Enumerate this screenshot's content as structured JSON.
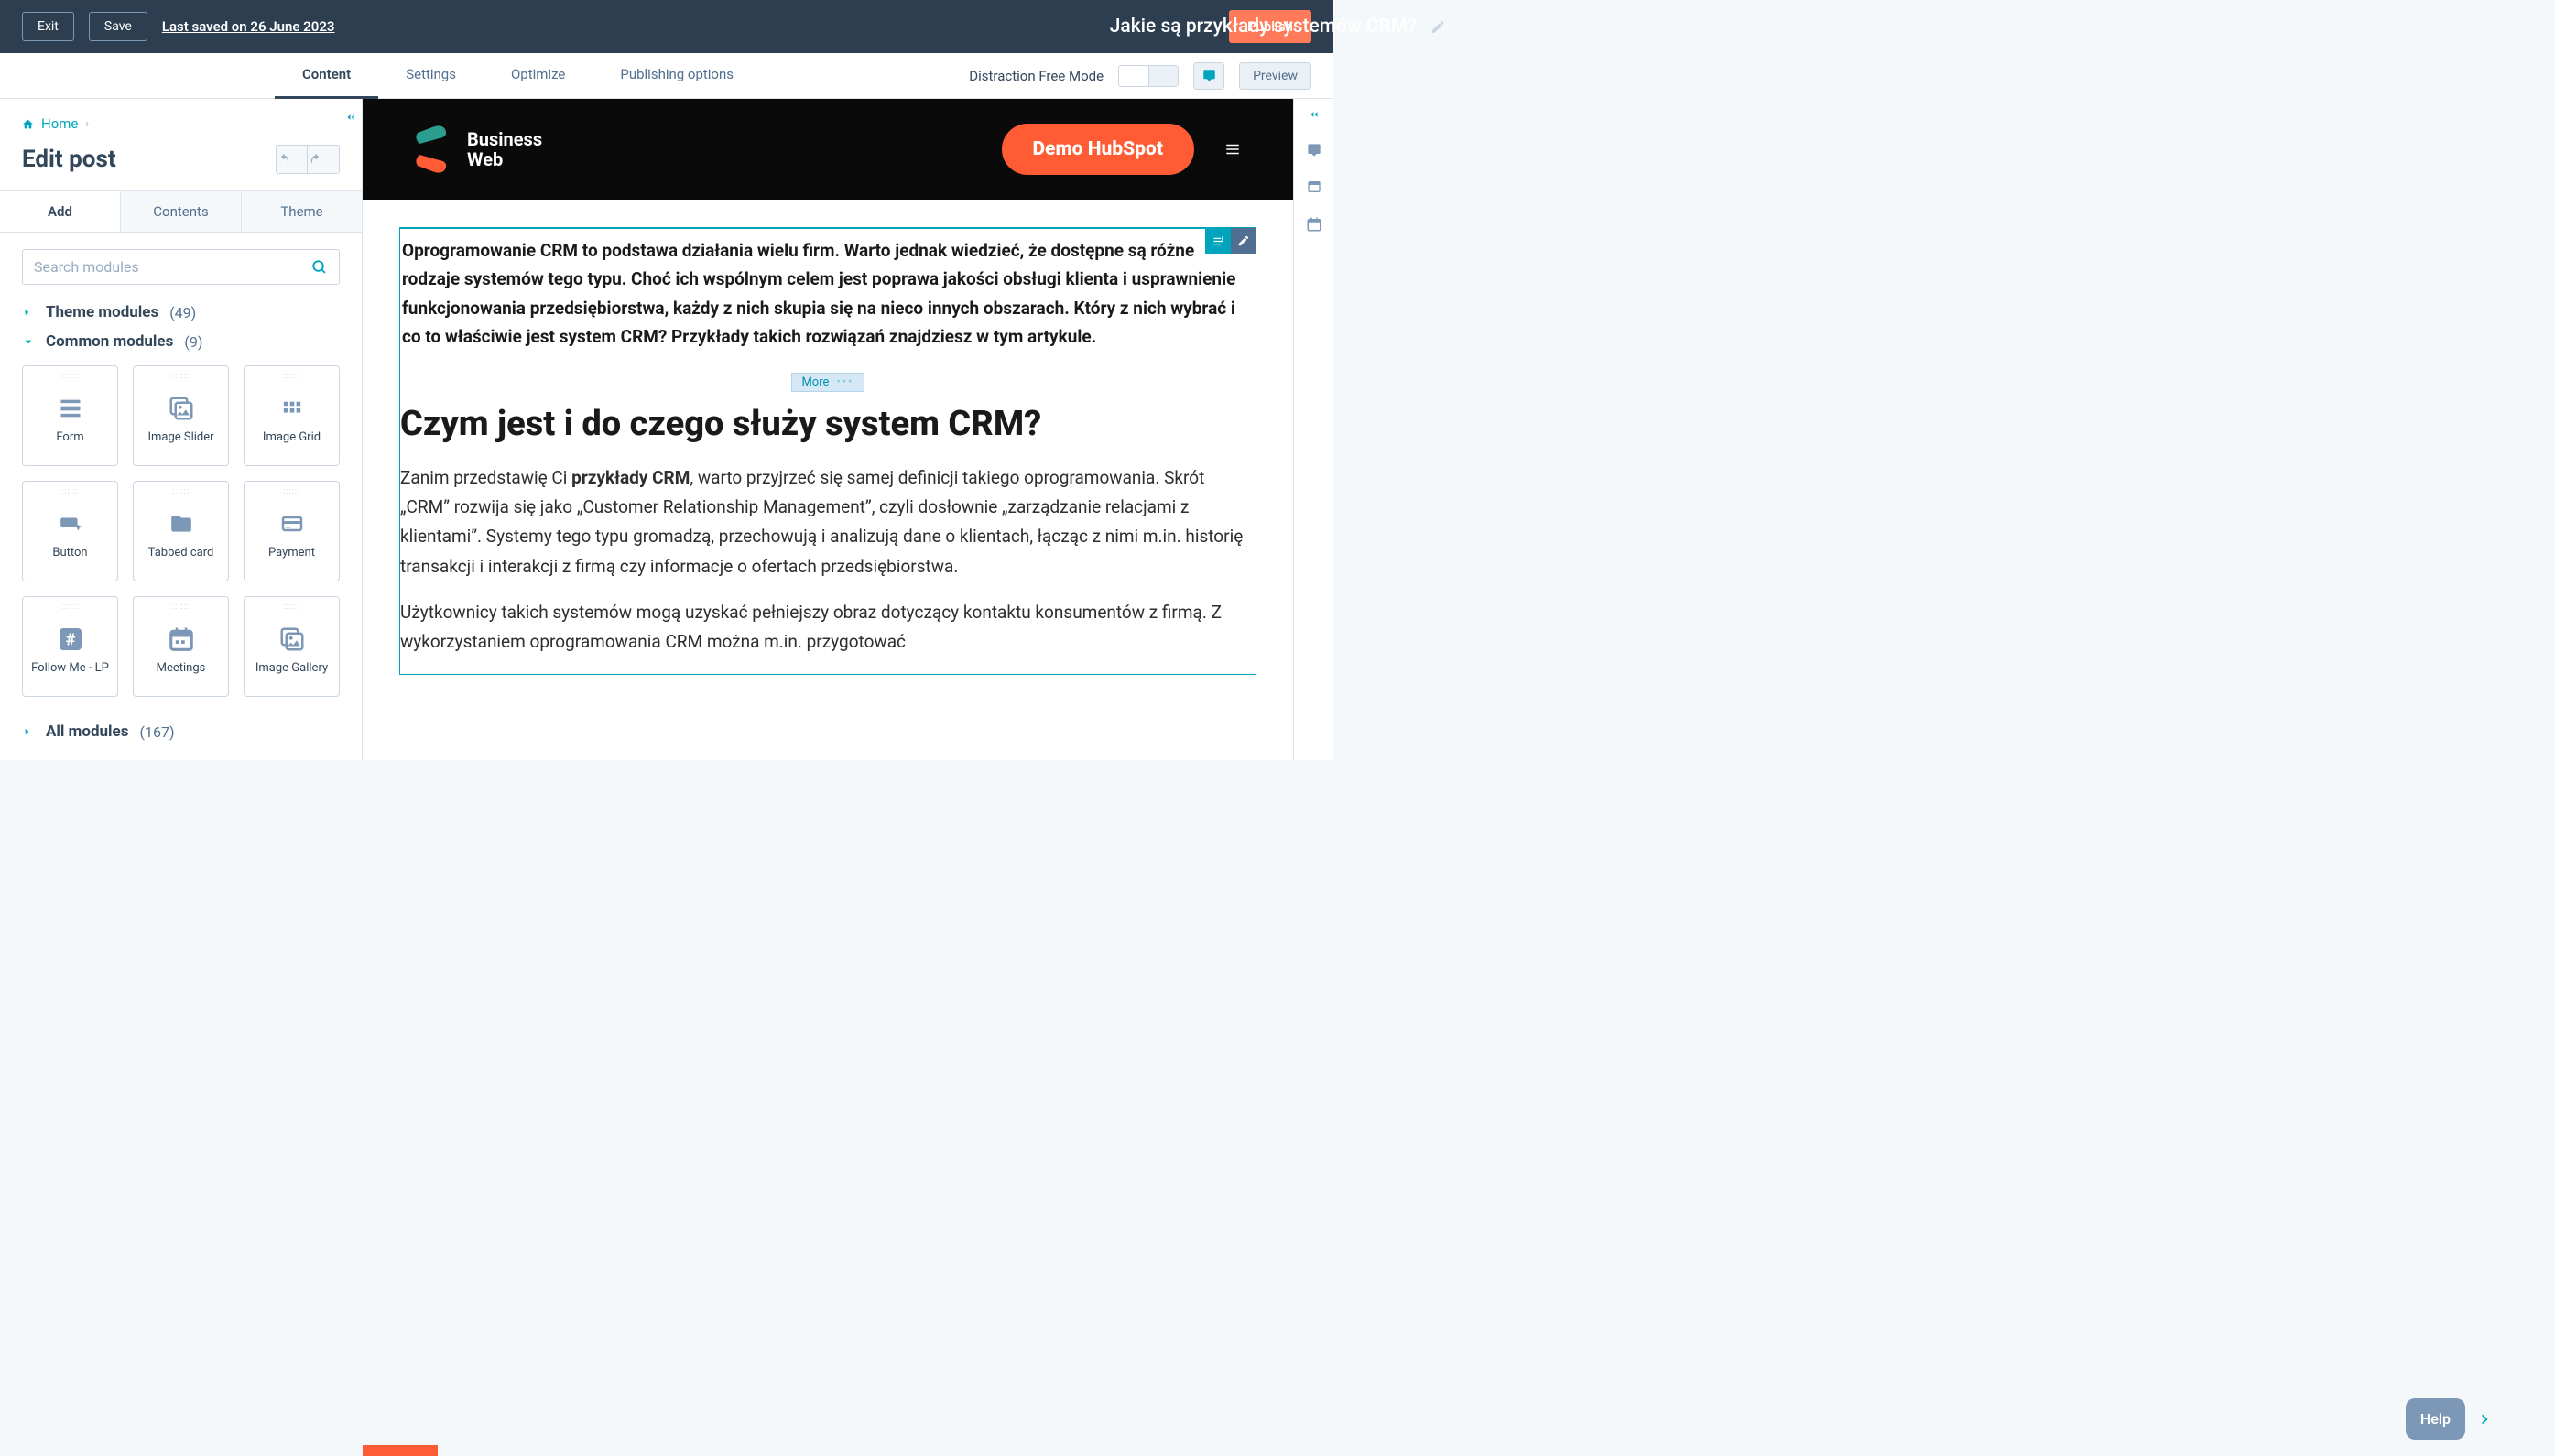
{
  "topbar": {
    "exit": "Exit",
    "save": "Save",
    "last_saved": "Last saved on 26 June 2023",
    "title": "Jakie są przykłady systemów CRM?",
    "publish": "Publish"
  },
  "tabs": {
    "content": "Content",
    "settings": "Settings",
    "optimize": "Optimize",
    "publishing": "Publishing options",
    "dfm": "Distraction Free Mode",
    "preview": "Preview"
  },
  "sidebar": {
    "home": "Home",
    "heading": "Edit post",
    "add": "Add",
    "contents": "Contents",
    "theme": "Theme",
    "search_placeholder": "Search modules",
    "theme_modules": "Theme modules",
    "theme_modules_count": "(49)",
    "common_modules": "Common modules",
    "common_modules_count": "(9)",
    "all_modules": "All modules",
    "all_modules_count": "(167)",
    "modules": [
      {
        "label": "Form"
      },
      {
        "label": "Image Slider"
      },
      {
        "label": "Image Grid"
      },
      {
        "label": "Button"
      },
      {
        "label": "Tabbed card"
      },
      {
        "label": "Payment"
      },
      {
        "label": "Follow Me - LP"
      },
      {
        "label": "Meetings"
      },
      {
        "label": "Image Gallery"
      }
    ]
  },
  "page": {
    "brand_line1": "Business",
    "brand_line2": "Web",
    "demo": "Demo HubSpot",
    "intro": "Oprogramowanie CRM to podstawa działania wielu firm. Warto jednak wiedzieć, że dostępne są różne rodzaje systemów tego typu. Choć ich wspólnym celem jest poprawa jakości obsługi klienta i usprawnienie funkcjonowania przedsiębiorstwa, każdy z nich skupia się na nieco innych obszarach. Który z nich wybrać i co to właściwie jest system CRM? Przykłady takich rozwiązań znajdziesz w tym artykule.",
    "more": "More",
    "h2": "Czym jest i do czego służy system CRM?",
    "p1_a": "Zanim przedstawię Ci ",
    "p1_b": "przykłady CRM",
    "p1_c": ", warto przyjrzeć się samej definicji takiego oprogramowania. Skrót „CRM” rozwija się jako „Customer Relationship Management”, czyli dosłownie „zarządzanie relacjami z klientami”. Systemy tego typu gromadzą, przechowują i analizują dane o klientach, łącząc z nimi m.in. historię transakcji i interakcji z firmą czy informacje o ofertach przedsiębiorstwa.",
    "p2": "Użytkownicy takich systemów mogą uzyskać pełniejszy obraz dotyczący kontaktu konsumentów z firmą. Z wykorzystaniem oprogramowania CRM można m.in. przygotować"
  },
  "help": {
    "label": "Help"
  }
}
